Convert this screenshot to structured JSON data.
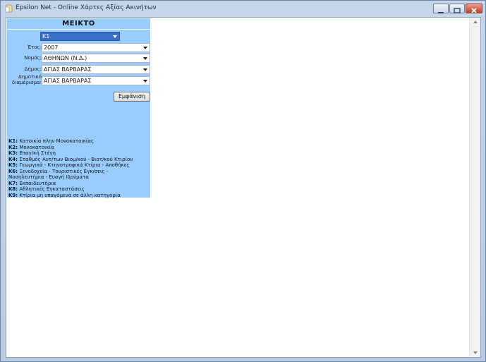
{
  "window": {
    "title": "Epsilon Net - Online Χάρτες Αξίας Ακινήτων",
    "controls": [
      "minimize",
      "maximize",
      "close"
    ]
  },
  "panel": {
    "title": "ΜΕΙΚΤΟ",
    "category_select": {
      "value": "K1"
    },
    "fields": [
      {
        "label": "Έτος:",
        "value": "2007"
      },
      {
        "label": "Νομός:",
        "value": "ΑΘΗΝΩΝ (Ν.Δ.)"
      },
      {
        "label": "Δήμος:",
        "value": "ΑΓΙΑΣ ΒΑΡΒΑΡΑΣ"
      },
      {
        "label_line1": "Δημοτικό",
        "label_line2": "διαμέρισμα:",
        "value": "ΑΓΙΑΣ ΒΑΡΒΑΡΑΣ"
      }
    ],
    "show_button": "Εμφάνιση",
    "legend": [
      {
        "code": "K1:",
        "text": "Κατοικία πλην Μονοκατοικίας"
      },
      {
        "code": "K2:",
        "text": "Μονοκατοικία"
      },
      {
        "code": "K3:",
        "text": "Επαγ/κή Στέγη"
      },
      {
        "code": "K4:",
        "text": "Σταθμός Αυτ/των Βιομ/κού - Βιοτ/κού Κτιρίου"
      },
      {
        "code": "K5:",
        "text": "Γεωργικά - Κτηνοτροφικά Κτίρια - Αποθήκες"
      },
      {
        "code": "K6:",
        "text": "Ξενοδοχεία - Τουριστικές Εγκ/σεις -",
        "continuation": "Νοσηλευτήρια - Ευαγή Ιδρύματα"
      },
      {
        "code": "K7:",
        "text": "Εκπαιδευτήρια"
      },
      {
        "code": "K8:",
        "text": "Αθλητικές Εγκαταστάσεις"
      },
      {
        "code": "K9:",
        "text": "Κτίρια μη υπαγόμενα σε άλλη κατηγορία"
      }
    ]
  },
  "icons": {
    "app": "app-icon",
    "scroll_up": "scroll-up-arrow-icon",
    "scroll_down": "scroll-down-arrow-icon"
  }
}
